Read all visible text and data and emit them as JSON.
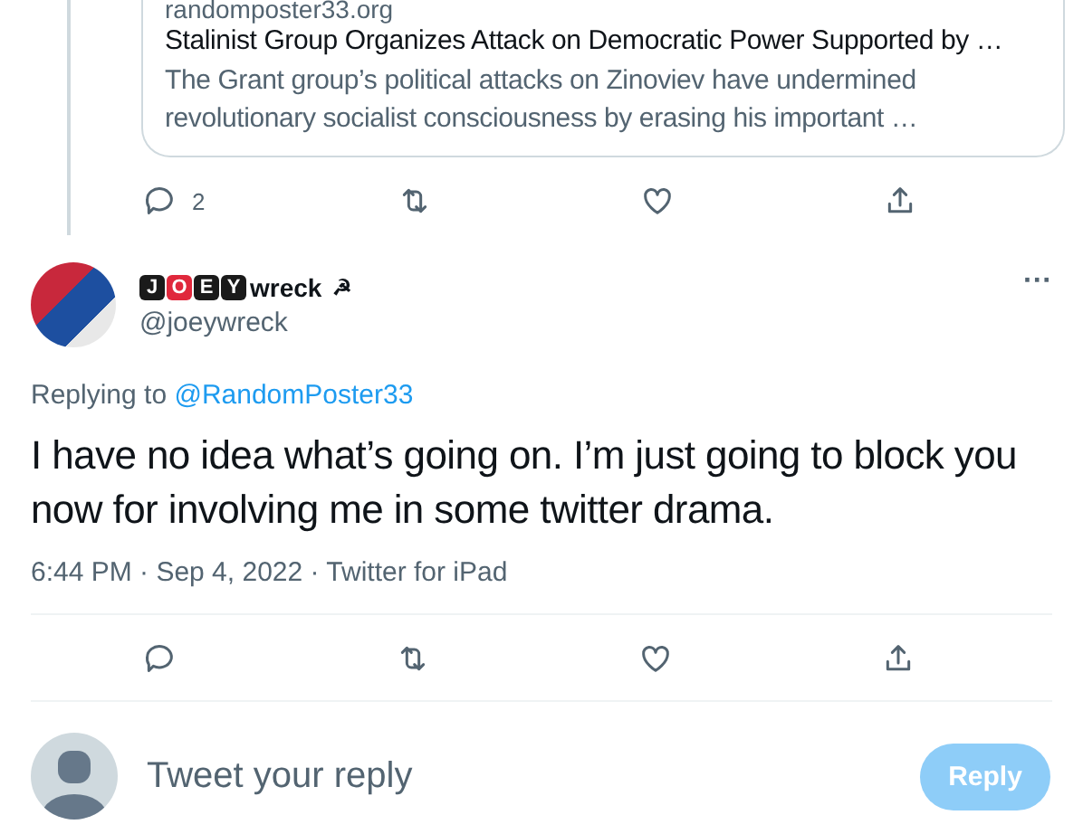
{
  "quoted_tweet": {
    "domain": "randomposter33.org",
    "title": "Stalinist Group Organizes Attack on Democratic Power Supported by …",
    "description": "The Grant group’s political attacks on Zinoviev have undermined revolutionary socialist consciousness by erasing his important …",
    "reply_count": "2"
  },
  "tweet": {
    "name_letters": [
      {
        "text": "J",
        "color": "#1a1a1a"
      },
      {
        "text": "O",
        "color": "#e0283c"
      },
      {
        "text": "E",
        "color": "#1a1a1a"
      },
      {
        "text": "Y",
        "color": "#1a1a1a"
      }
    ],
    "name_rest": "wreck",
    "name_symbol": "☭",
    "handle": "@joeywreck",
    "more": "···",
    "replying_label": "Replying to",
    "replying_handle": "@RandomPoster33",
    "text": "I have no idea what’s going on. I’m just going to block you now for involving me in some twitter drama.",
    "meta": "6:44 PM · Sep 4, 2022 · Twitter for iPad"
  },
  "composer": {
    "placeholder": "Tweet your reply",
    "button": "Reply",
    "disabled": true
  }
}
